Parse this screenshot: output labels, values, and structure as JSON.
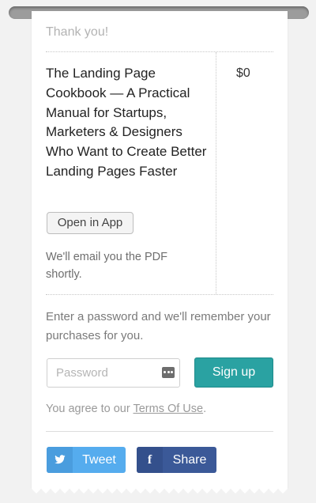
{
  "receipt": {
    "thank_you": "Thank you!",
    "product_title": "The Landing Page Cookbook — A Practical Manual for Startups, Marketers & Designers Who Want to Create Better Landing Pages Faster",
    "price": "$0",
    "open_in_app_label": "Open in App",
    "email_note": "We'll email you the PDF shortly."
  },
  "account": {
    "prompt": "Enter a password and we'll remember your purchases for you.",
    "password_placeholder": "Password",
    "signup_label": "Sign up",
    "agree_prefix": "You agree to our ",
    "terms_link": "Terms Of Use",
    "agree_suffix": "."
  },
  "social": {
    "tweet_label": "Tweet",
    "share_label": "Share",
    "share_glyph": "f"
  },
  "colors": {
    "accent": "#2aa2a2",
    "twitter": "#55acee",
    "facebook": "#3b5998"
  },
  "icons": {
    "password_manager": "key-icon",
    "twitter": "twitter-bird-icon",
    "facebook": "facebook-f-icon"
  }
}
